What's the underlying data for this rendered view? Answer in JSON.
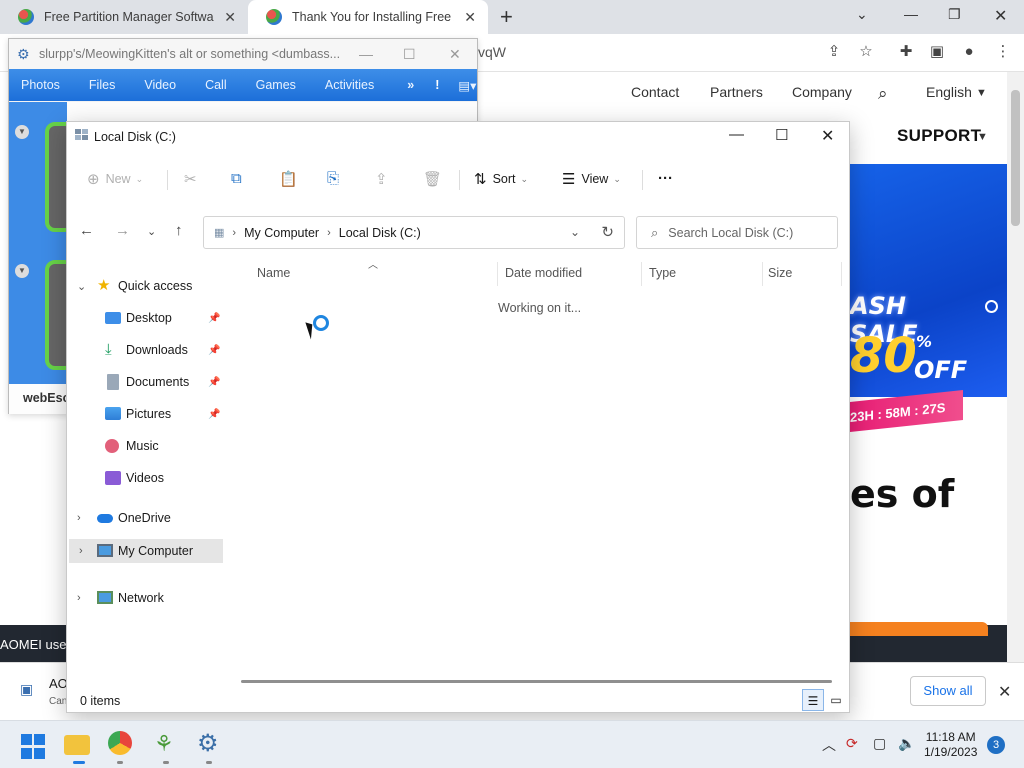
{
  "browser": {
    "tabs": [
      {
        "title": "Free Partition Manager Software"
      },
      {
        "title": "Thank You for Installing Free AOMEI"
      }
    ],
    "omnibox_fragment": "vqW"
  },
  "website": {
    "nav": [
      "Contact",
      "Partners",
      "Company"
    ],
    "language": "English",
    "support": "SUPPORT",
    "sale": {
      "top": "ASH SALE",
      "big": "80",
      "pct": "%",
      "off": "OFF",
      "timer": "23H : 58M : 27S"
    },
    "headline_fragment": "es of",
    "cookie_fragment": "AOMEI uses",
    "download": {
      "name": "AO",
      "sub": "Can",
      "show_all": "Show all"
    }
  },
  "chat": {
    "title": "slurpp's/MeowingKitten's alt or something <dumbass...",
    "menu": [
      "Photos",
      "Files",
      "Video",
      "Call",
      "Games",
      "Activities"
    ],
    "contact_name": "webEsca"
  },
  "explorer": {
    "title": "Local Disk (C:)",
    "toolbar": {
      "new": "New",
      "sort": "Sort",
      "view": "View"
    },
    "breadcrumb": [
      "My Computer",
      "Local Disk (C:)"
    ],
    "search_placeholder": "Search Local Disk (C:)",
    "sidebar": {
      "quick_access": "Quick access",
      "pinned": [
        "Desktop",
        "Downloads",
        "Documents",
        "Pictures"
      ],
      "unpinned": [
        "Music",
        "Videos"
      ],
      "onedrive": "OneDrive",
      "my_computer": "My Computer",
      "network": "Network"
    },
    "columns": [
      "Name",
      "Date modified",
      "Type",
      "Size"
    ],
    "loading_text": "Working on it...",
    "status": "0 items"
  },
  "taskbar": {
    "time": "11:18 AM",
    "date": "1/19/2023",
    "notification_count": "3"
  },
  "colors": {
    "accent": "#1f7ae0",
    "sale_yellow": "#ffcf2e",
    "sale_pink": "#e81e75",
    "skype_blue": "#3d8be6"
  }
}
